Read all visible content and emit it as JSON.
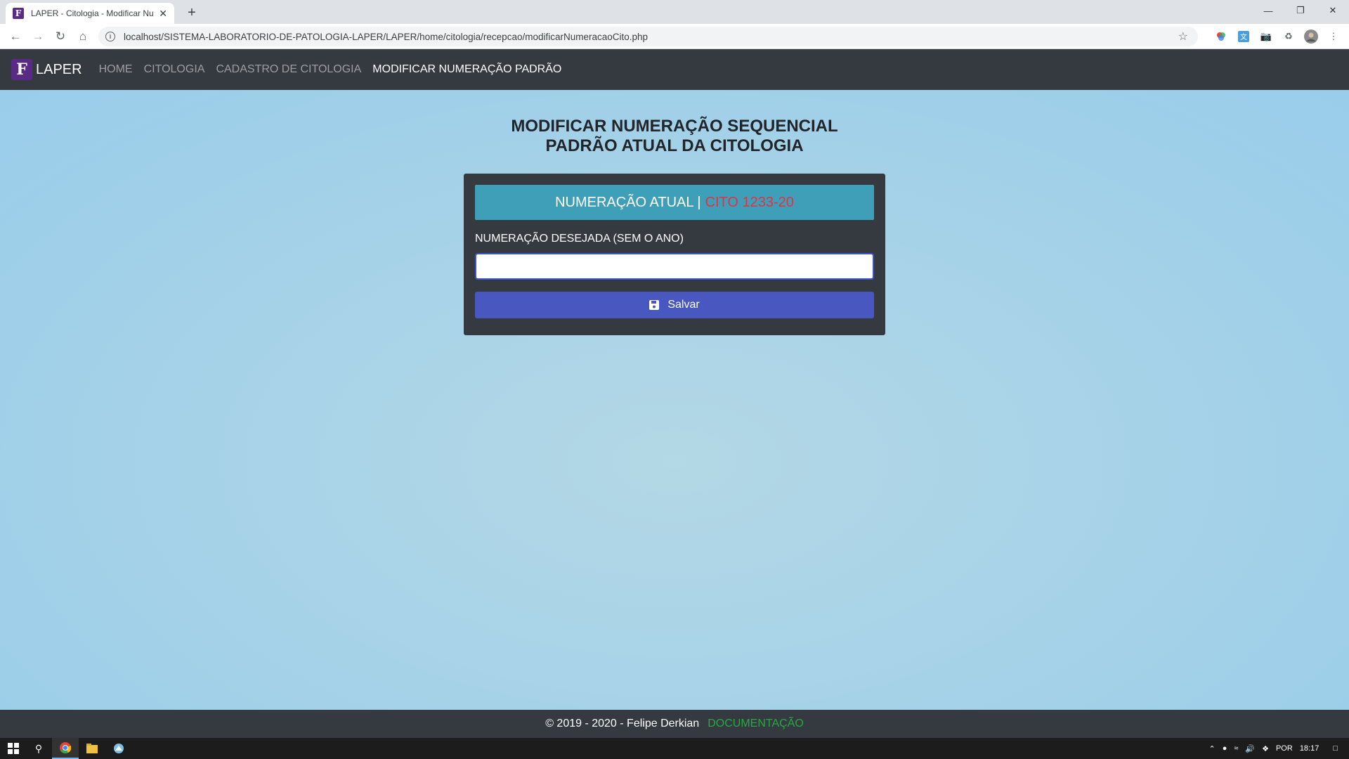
{
  "browser": {
    "tab_title": "LAPER - Citologia - Modificar Nu",
    "tab_favicon": "F",
    "tab_close": "✕",
    "new_tab": "+",
    "url": "localhost/SISTEMA-LABORATORIO-DE-PATOLOGIA-LAPER/LAPER/home/citologia/recepcao/modificarNumeracaoCito.php"
  },
  "navbar": {
    "logo_letter": "F",
    "brand": "LAPER",
    "links": [
      {
        "label": "HOME"
      },
      {
        "label": "CITOLOGIA"
      },
      {
        "label": "CADASTRO DE CITOLOGIA"
      },
      {
        "label": "MODIFICAR NUMERAÇÃO PADRÃO"
      }
    ]
  },
  "page": {
    "title_line1": "MODIFICAR NUMERAÇÃO SEQUENCIAL",
    "title_line2": "PADRÃO ATUAL DA CITOLOGIA",
    "current_label": "NUMERAÇÃO ATUAL |",
    "current_value": "CITO 1233-20",
    "field_label": "NUMERAÇÃO DESEJADA (SEM O ANO)",
    "field_value": "",
    "save_label": "Salvar"
  },
  "footer": {
    "copyright": "© 2019 - 2020 - Felipe Derkian",
    "doc_link": "DOCUMENTAÇÃO"
  },
  "taskbar": {
    "language": "POR",
    "time": "18:17"
  },
  "colors": {
    "navbar_bg": "#343a40",
    "current_box_bg": "#3f9fb8",
    "current_value": "#dc3545",
    "save_button": "#4858c0",
    "doc_link": "#28a745",
    "page_bg": "#a9d4e8"
  }
}
